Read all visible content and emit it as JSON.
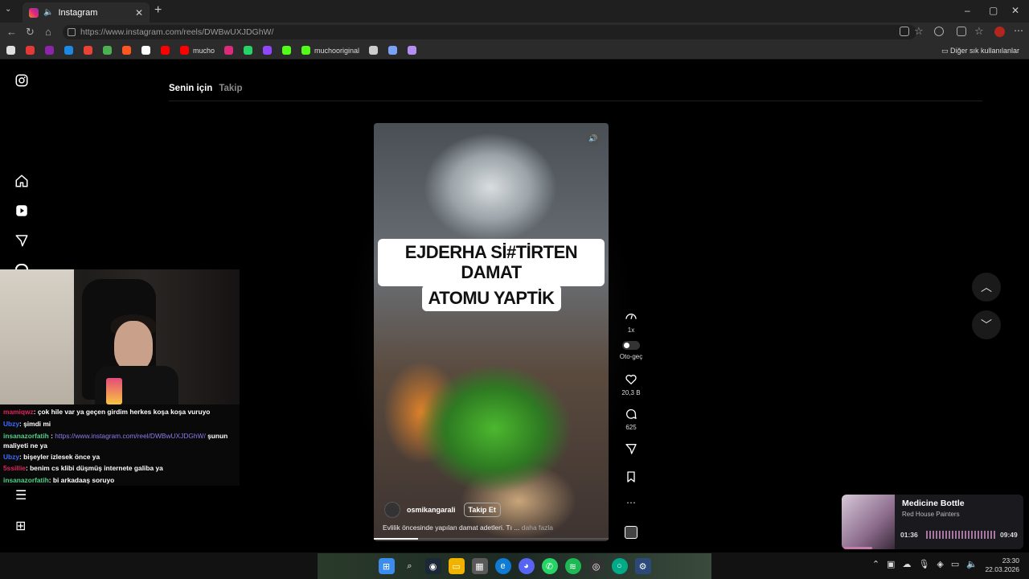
{
  "browser": {
    "tab_title": "Instagram",
    "url": "https://www.instagram.com/reels/DWBwUXJDGhW/",
    "new_tab": "+",
    "bookmarks": [
      {
        "label": "",
        "color": "#e0e0e0"
      },
      {
        "label": "",
        "color": "#e53935"
      },
      {
        "label": "",
        "color": "#8e24aa"
      },
      {
        "label": "",
        "color": "#1e88e5"
      },
      {
        "label": "",
        "color": "#ea4335"
      },
      {
        "label": "",
        "color": "#4caf50"
      },
      {
        "label": "",
        "color": "#ff5722"
      },
      {
        "label": "",
        "color": "#ffffff"
      },
      {
        "label": "",
        "color": "#ff0000"
      },
      {
        "label": "mucho",
        "color": "#ff0000"
      },
      {
        "label": "",
        "color": "#dd2a7b"
      },
      {
        "label": "",
        "color": "#25d366"
      },
      {
        "label": "",
        "color": "#9146ff"
      },
      {
        "label": "",
        "color": "#53fc18"
      },
      {
        "label": "muchooriginal",
        "color": "#53fc18"
      },
      {
        "label": "",
        "color": "#cccccc"
      },
      {
        "label": "",
        "color": "#7aa2f7"
      },
      {
        "label": "",
        "color": "#b48ef0"
      }
    ],
    "other_bookmarks": "Diğer sık kullanılanlar"
  },
  "instagram": {
    "tabs": [
      "Senin için",
      "Takip"
    ],
    "reel": {
      "caption_line1": "EJDERHA Sİ#TİRTEN DAMAT",
      "caption_line2": "ATOMU YAPTİK",
      "author": "osmikangarali",
      "follow_label": "Takip Et",
      "description": "Evlilik öncesinde yapılan damat adetleri. Tı ...",
      "more_label": "daha fazla",
      "progress": 0.19
    },
    "actions": {
      "speed": "1x",
      "autoplay": "Oto-geç",
      "likes": "20,3 B",
      "comments": "625"
    }
  },
  "chat": [
    {
      "user": "mamiqwz",
      "color": "#e0245e",
      "text": ": çok hile var ya geçen girdim herkes koşa koşa vuruyo"
    },
    {
      "user": "Ubzy",
      "color": "#3d6bff",
      "text": ": şimdi mi"
    },
    {
      "user": "insanazorfatih",
      "color": "#4fd08a",
      "link": "https://www.instagram.com/reel/DWBwUXJDGhW/",
      "text": " şunun maliyeti ne ya"
    },
    {
      "user": "Ubzy",
      "color": "#3d6bff",
      "text": ": bişeyler izlesek önce ya"
    },
    {
      "user": "5ssillie",
      "color": "#e0245e",
      "text": ": benim cs klibi düşmüş internete galiba ya"
    },
    {
      "user": "insanazorfatih",
      "color": "#4fd08a",
      "text": ": bi arkadaaş soruyo"
    }
  ],
  "music": {
    "title": "Medicine Bottle",
    "artist": "Red House Painters",
    "elapsed": "01:36",
    "total": "09:49"
  },
  "taskbar": {
    "time": "23:30",
    "date": "22.03.2026"
  }
}
